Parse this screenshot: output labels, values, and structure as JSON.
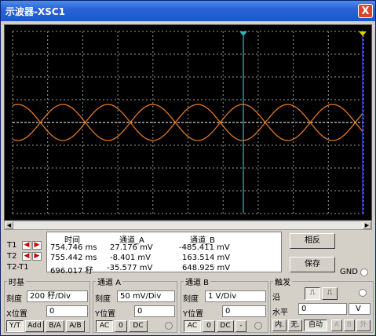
{
  "title": "示波器-XSC1",
  "close_glyph": "X",
  "readout": {
    "headers": {
      "time": "时间",
      "ch_a": "通道_A",
      "ch_b": "通道_B"
    },
    "rows": [
      {
        "label": "T1",
        "time": "754.746 ms",
        "a": "27.176 mV",
        "b": "-485.411 mV"
      },
      {
        "label": "T2",
        "time": "755.442 ms",
        "a": "-8.401 mV",
        "b": "163.514 mV"
      },
      {
        "label": "T2-T1",
        "time": "696.017 秄",
        "a": "-35.577 mV",
        "b": "648.925 mV"
      }
    ]
  },
  "buttons": {
    "reverse": "相反",
    "save": "保存",
    "gnd": "GND"
  },
  "timebase": {
    "title": "时基",
    "scale_label": "刻度",
    "scale": "200 秄/Div",
    "xpos_label": "X位置",
    "xpos": "0",
    "modes": [
      "Y/T",
      "Add",
      "B/A",
      "A/B"
    ]
  },
  "channel_a": {
    "title": "通道 A",
    "scale_label": "刻度",
    "scale": "50 mV/Div",
    "ypos_label": "Y位置",
    "ypos": "0",
    "coupling": [
      "AC",
      "0",
      "DC"
    ]
  },
  "channel_b": {
    "title": "通道 B",
    "scale_label": "刻度",
    "scale": "1 V/Div",
    "ypos_label": "Y位置",
    "ypos": "0",
    "coupling": [
      "AC",
      "0",
      "DC",
      "-"
    ]
  },
  "trigger": {
    "title": "触发",
    "edge_label": "沿",
    "level_label": "水平",
    "level": "0",
    "level_unit": "V",
    "modes": [
      "内.",
      "无.",
      "自动"
    ],
    "sources": [
      "A",
      "B",
      "外"
    ]
  },
  "colors": {
    "trace": "#e07820",
    "cursor": "#20c0c0",
    "cursor2": "#e0d000",
    "grid": "#9a9a9a",
    "screen": "#000000"
  }
}
